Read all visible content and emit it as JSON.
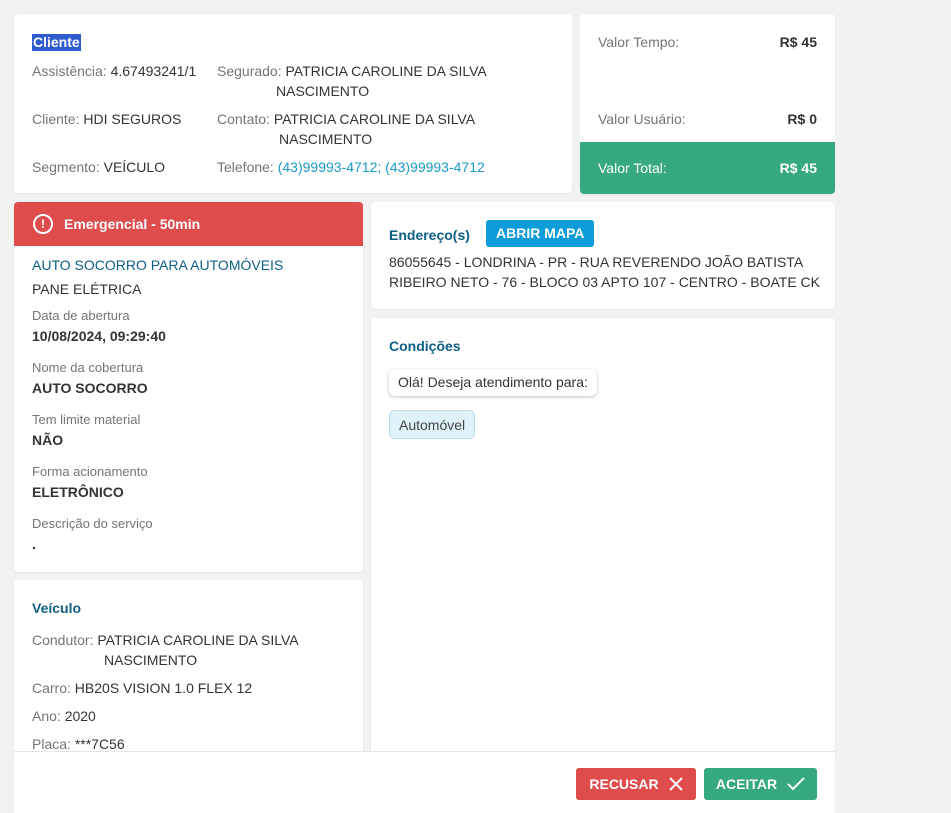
{
  "client": {
    "title": "Cliente",
    "assistencia_label": "Assistência:",
    "assistencia_value": "4.67493241/1",
    "segurado_label": "Segurado:",
    "segurado_value_1": "PATRICIA CAROLINE DA SILVA",
    "segurado_value_2": "NASCIMENTO",
    "cliente_label": "Cliente:",
    "cliente_value": "HDI SEGUROS",
    "contato_label": "Contato:",
    "contato_value_1": "PATRICIA CAROLINE DA SILVA",
    "contato_value_2": "NASCIMENTO",
    "segmento_label": "Segmento:",
    "segmento_value": "VEÍCULO",
    "telefone_label": "Telefone:",
    "telefone_value": "(43)99993-4712; (43)99993-4712"
  },
  "values": {
    "tempo_label": "Valor Tempo:",
    "tempo_value": "R$ 45",
    "usuario_label": "Valor Usuário:",
    "usuario_value": "R$ 0",
    "total_label": "Valor Total:",
    "total_value": "R$ 45"
  },
  "service": {
    "banner": "Emergencial - 50min",
    "type": "AUTO SOCORRO PARA AUTOMÓVEIS",
    "subtype": "PANE ELÉTRICA",
    "abertura_label": "Data de abertura",
    "abertura_value": "10/08/2024, 09:29:40",
    "cobertura_label": "Nome da cobertura",
    "cobertura_value": "AUTO SOCORRO",
    "limite_label": "Tem limite material",
    "limite_value": "NÃO",
    "acionamento_label": "Forma acionamento",
    "acionamento_value": "ELETRÔNICO",
    "descricao_label": "Descrição do serviço",
    "descricao_value": "."
  },
  "vehicle": {
    "title": "Veículo",
    "condutor_label": "Condutor:",
    "condutor_value_1": "PATRICIA CAROLINE DA SILVA",
    "condutor_value_2": "NASCIMENTO",
    "carro_label": "Carro:",
    "carro_value": "HB20S VISION 1.0 FLEX 12",
    "ano_label": "Ano:",
    "ano_value": "2020",
    "placa_label": "Placa:",
    "placa_value": "***7C56"
  },
  "address": {
    "title": "Endereço(s)",
    "map_button": "ABRIR MAPA",
    "line1": "86055645 - LONDRINA - PR - RUA REVERENDO JOÃO BATISTA",
    "line2": "RIBEIRO NETO - 76 - BLOCO 03 APTO 107 - CENTRO - BOATE CK"
  },
  "conditions": {
    "title": "Condições",
    "question": "Olá! Deseja atendimento para:",
    "answer": "Automóvel"
  },
  "actions": {
    "refuse": "RECUSAR",
    "accept": "ACEITAR"
  },
  "colors": {
    "green": "#37a97e",
    "red": "#de4c4c",
    "blue": "#0e9dd8"
  }
}
